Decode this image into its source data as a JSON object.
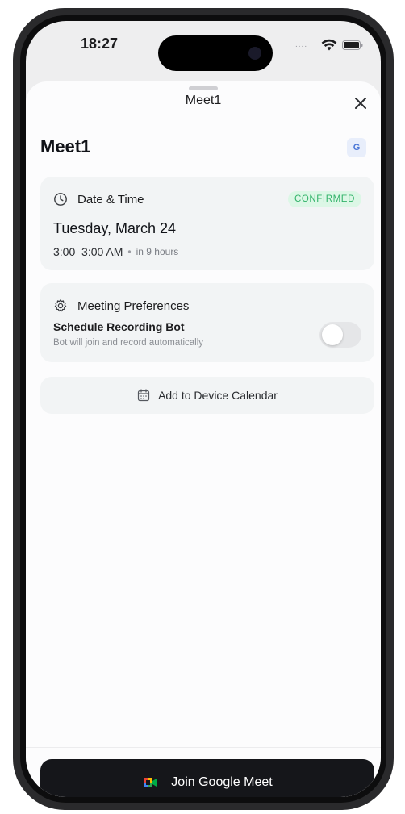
{
  "status_bar": {
    "time": "18:27",
    "signal": "....",
    "wifi_icon": "wifi-icon",
    "battery_icon": "battery-icon"
  },
  "sheet": {
    "title": "Meet1",
    "close_icon": "close-icon"
  },
  "meeting": {
    "title": "Meet1",
    "provider_badge": "G",
    "date_card": {
      "header_label": "Date & Time",
      "status": "CONFIRMED",
      "date": "Tuesday, March 24",
      "time_range": "3:00–3:00 AM",
      "separator": "•",
      "relative": "in 9 hours"
    },
    "prefs_card": {
      "header_label": "Meeting Preferences",
      "recording_title": "Schedule Recording Bot",
      "recording_subtitle": "Bot will join and record automatically",
      "recording_enabled": false
    },
    "calendar_button_label": "Add to Device Calendar",
    "join_button_label": "Join Google Meet"
  },
  "colors": {
    "confirmed_text": "#33b36a",
    "confirmed_bg": "#dcf7e6",
    "join_button_bg": "#15161a",
    "google_badge": "#4a76d6"
  }
}
